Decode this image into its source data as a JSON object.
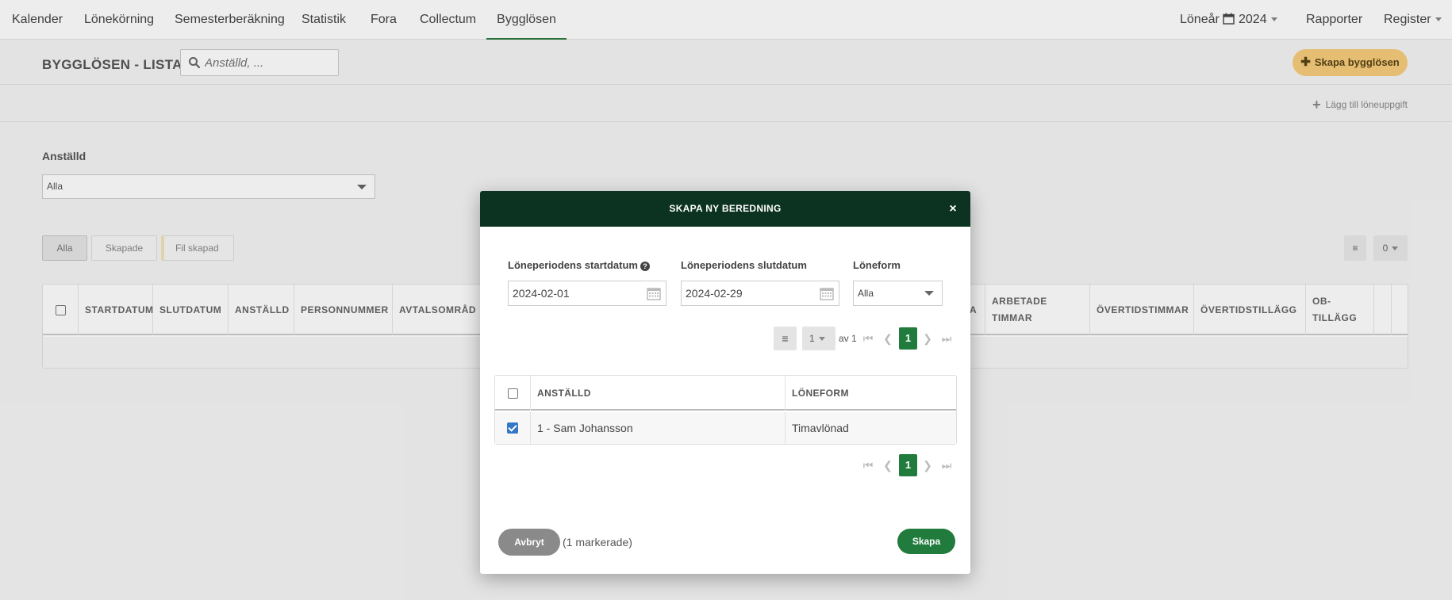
{
  "nav": {
    "items": [
      {
        "label": "Kalender"
      },
      {
        "label": "Lönekörning"
      },
      {
        "label": "Semesterberäkning"
      },
      {
        "label": "Statistik"
      },
      {
        "label": "Fora"
      },
      {
        "label": "Collectum"
      },
      {
        "label": "Bygglösen"
      }
    ],
    "active": "Bygglösen",
    "year_label": "Löneår",
    "year_value": "2024",
    "reports": "Rapporter",
    "register": "Register"
  },
  "header": {
    "title": "BYGGLÖSEN - LISTA",
    "search_placeholder": "Anställd, ...",
    "create_button": "Skapa bygglösen",
    "add_task": "Lägg till löneuppgift"
  },
  "filter": {
    "label": "Anställd",
    "value": "Alla"
  },
  "tabs": [
    {
      "label": "Alla"
    },
    {
      "label": "Skapade"
    },
    {
      "label": "Fil skapad"
    }
  ],
  "table_tools": {
    "count": "0"
  },
  "table": {
    "columns_left": [
      "STARTDATUM",
      "SLUTDATUM",
      "ANSTÄLLD",
      "PERSONNUMMER",
      "AVTALSOMRÅD"
    ],
    "columns_right": [
      "A",
      "ARBETADE TIMMAR",
      "ÖVERTIDSTIMMAR",
      "ÖVERTIDSTILLÄGG",
      "OB-TILLÄGG"
    ]
  },
  "modal": {
    "title": "SKAPA NY BEREDNING",
    "close": "×",
    "start_label": "Löneperiodens startdatum",
    "start_value": "2024-02-01",
    "end_label": "Löneperiodens slutdatum",
    "end_value": "2024-02-29",
    "form_label": "Löneform",
    "form_value": "Alla",
    "page_size": "1",
    "of_label": "av 1",
    "page": "1",
    "columns": [
      "ANSTÄLLD",
      "LÖNEFORM"
    ],
    "rows": [
      {
        "employee": "1 - Sam Johansson",
        "form": "Timavlönad",
        "checked": true
      }
    ],
    "cancel": "Avbryt",
    "selected": "(1 markerade)",
    "create": "Skapa"
  }
}
